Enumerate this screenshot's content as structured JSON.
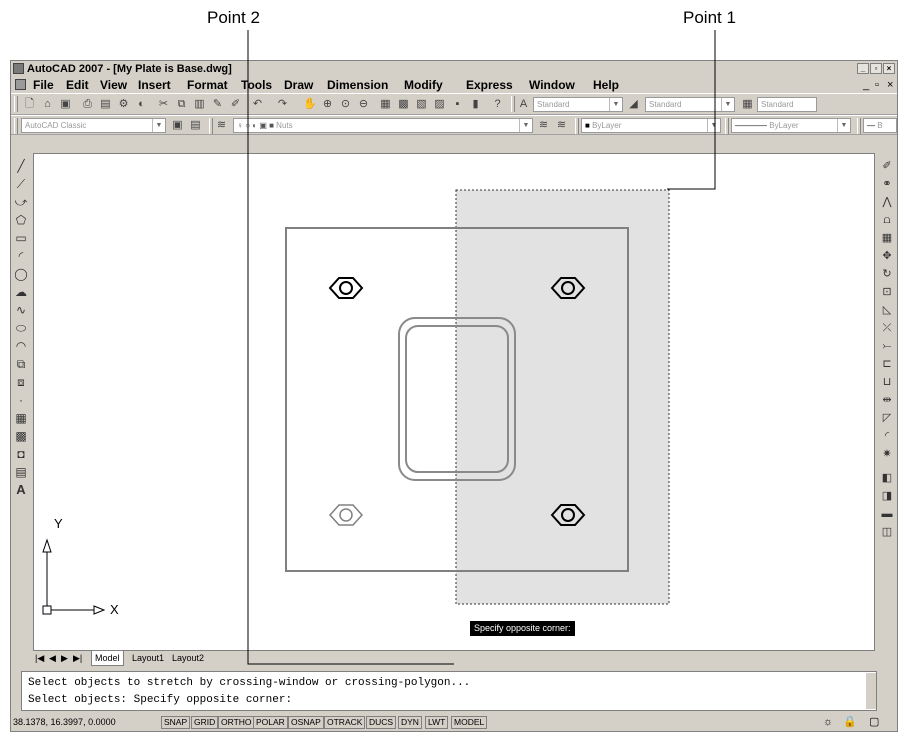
{
  "callouts": {
    "point2": "Point 2",
    "point1": "Point 1"
  },
  "window": {
    "title": "AutoCAD 2007 - [My Plate is Base.dwg]"
  },
  "menu": [
    "File",
    "Edit",
    "View",
    "Insert",
    "Format",
    "Tools",
    "Draw",
    "Dimension",
    "Modify",
    "Express",
    "Window",
    "Help"
  ],
  "toolbar": {
    "text_style": "Standard",
    "dim_style": "Standard",
    "table_style": "Standard",
    "workspace": "AutoCAD Classic",
    "layer": "Nuts",
    "color": "ByLayer",
    "linetype": "ByLayer",
    "lineweight": "B"
  },
  "canvas": {
    "tooltip": "Specify opposite corner:",
    "ucs_x": "X",
    "ucs_y": "Y"
  },
  "tabs": {
    "model": "Model",
    "layout1": "Layout1",
    "layout2": "Layout2"
  },
  "command": {
    "line1": "Select objects to stretch by crossing-window or crossing-polygon...",
    "line2": "Select objects: Specify opposite corner:"
  },
  "status": {
    "coords": "38.1378, 16.3997, 0.0000",
    "buttons": [
      "SNAP",
      "GRID",
      "ORTHO",
      "POLAR",
      "OSNAP",
      "OTRACK",
      "DUCS",
      "DYN",
      "LWT",
      "MODEL"
    ]
  },
  "colors": {
    "selection_fill": "#e2e2e2",
    "chrome": "#d4d0c8"
  }
}
